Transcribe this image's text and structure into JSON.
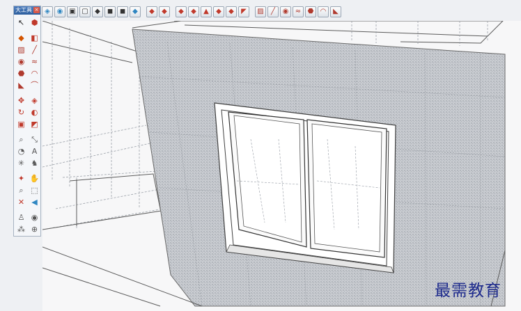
{
  "tool_palette": {
    "title": "大工具",
    "close_glyph": "×",
    "tools": [
      {
        "name": "select-tool-icon",
        "glyph": "↖",
        "color": "#222222"
      },
      {
        "name": "make-component-icon",
        "glyph": "⬢",
        "color": "#c0392b"
      },
      {
        "name": "paint-bucket-icon",
        "glyph": "◆",
        "color": "#d35400"
      },
      {
        "name": "eraser-icon",
        "glyph": "◧",
        "color": "#c0392b"
      },
      {
        "name": "rectangle-tool-icon",
        "glyph": "▨",
        "color": "#b03a2e"
      },
      {
        "name": "line-tool-icon",
        "glyph": "╱",
        "color": "#b03a2e"
      },
      {
        "name": "circle-tool-icon",
        "glyph": "◉",
        "color": "#b03a2e"
      },
      {
        "name": "freehand-tool-icon",
        "glyph": "≈",
        "color": "#b03a2e"
      },
      {
        "name": "polygon-tool-icon",
        "glyph": "⬣",
        "color": "#b03a2e"
      },
      {
        "name": "arc-tool-icon",
        "glyph": "◠",
        "color": "#b03a2e"
      },
      {
        "name": "pie-tool-icon",
        "glyph": "◣",
        "color": "#b03a2e"
      },
      {
        "name": "two-point-arc-icon",
        "glyph": "⌒",
        "color": "#b03a2e"
      },
      {
        "name": "move-tool-icon",
        "glyph": "✥",
        "color": "#c0392b"
      },
      {
        "name": "push-pull-tool-icon",
        "glyph": "◈",
        "color": "#c0392b"
      },
      {
        "name": "rotate-tool-icon",
        "glyph": "↻",
        "color": "#c0392b"
      },
      {
        "name": "follow-me-tool-icon",
        "glyph": "◐",
        "color": "#c0392b"
      },
      {
        "name": "scale-tool-icon",
        "glyph": "▣",
        "color": "#c0392b"
      },
      {
        "name": "offset-tool-icon",
        "glyph": "◩",
        "color": "#c0392b"
      },
      {
        "name": "tape-measure-icon",
        "glyph": "⌕",
        "color": "#555555"
      },
      {
        "name": "dimension-tool-icon",
        "glyph": "⤡",
        "color": "#555555"
      },
      {
        "name": "protractor-tool-icon",
        "glyph": "◔",
        "color": "#555555"
      },
      {
        "name": "text-tool-icon",
        "glyph": "A",
        "color": "#555555"
      },
      {
        "name": "axes-tool-icon",
        "glyph": "✳",
        "color": "#555555"
      },
      {
        "name": "3d-text-tool-icon",
        "glyph": "♞",
        "color": "#555555"
      },
      {
        "name": "orbit-tool-icon",
        "glyph": "✦",
        "color": "#c0392b"
      },
      {
        "name": "pan-tool-icon",
        "glyph": "✋",
        "color": "#555555"
      },
      {
        "name": "zoom-tool-icon",
        "glyph": "⌕",
        "color": "#555555"
      },
      {
        "name": "zoom-window-icon",
        "glyph": "⬚",
        "color": "#555555"
      },
      {
        "name": "zoom-extents-icon",
        "glyph": "✕",
        "color": "#c0392b"
      },
      {
        "name": "previous-view-icon",
        "glyph": "◀",
        "color": "#2e86c1"
      },
      {
        "name": "position-camera-icon",
        "glyph": "♙",
        "color": "#555555"
      },
      {
        "name": "look-around-icon",
        "glyph": "◉",
        "color": "#555555"
      },
      {
        "name": "walk-tool-icon",
        "glyph": "⁂",
        "color": "#555555"
      },
      {
        "name": "section-plane-icon",
        "glyph": "⊕",
        "color": "#555555"
      }
    ]
  },
  "top_toolbar": {
    "tools": [
      {
        "name": "iso-view-icon",
        "glyph": "◈",
        "color": "#2e86c1"
      },
      {
        "name": "top-view-icon",
        "glyph": "◉",
        "color": "#2e86c1"
      },
      {
        "name": "front-view-icon",
        "glyph": "▣",
        "color": "#333333"
      },
      {
        "name": "xray-style-icon",
        "glyph": "▢",
        "color": "#333333"
      },
      {
        "name": "wireframe-style-icon",
        "glyph": "◆",
        "color": "#333333"
      },
      {
        "name": "hidden-line-style-icon",
        "glyph": "◼",
        "color": "#333333"
      },
      {
        "name": "shaded-style-icon",
        "glyph": "◼",
        "color": "#333333"
      },
      {
        "name": "shaded-texture-style-icon",
        "glyph": "◆",
        "color": "#2e86c1"
      },
      {
        "name": "sep",
        "glyph": "",
        "color": ""
      },
      {
        "name": "solid-tools-union-icon",
        "glyph": "◆",
        "color": "#c0392b"
      },
      {
        "name": "solid-tools-subtract-icon",
        "glyph": "◆",
        "color": "#c0392b"
      },
      {
        "name": "sep",
        "glyph": "",
        "color": ""
      },
      {
        "name": "sandbox-from-contours-icon",
        "glyph": "◆",
        "color": "#c0392b"
      },
      {
        "name": "sandbox-from-scratch-icon",
        "glyph": "◆",
        "color": "#c0392b"
      },
      {
        "name": "sandbox-smoove-icon",
        "glyph": "▲",
        "color": "#c0392b"
      },
      {
        "name": "sandbox-stamp-icon",
        "glyph": "◆",
        "color": "#c0392b"
      },
      {
        "name": "sandbox-drape-icon",
        "glyph": "◆",
        "color": "#c0392b"
      },
      {
        "name": "sandbox-flip-edge-icon",
        "glyph": "◤",
        "color": "#c0392b"
      },
      {
        "name": "sep",
        "glyph": "",
        "color": ""
      },
      {
        "name": "rectangle-icon",
        "glyph": "▨",
        "color": "#b03a2e"
      },
      {
        "name": "line-icon",
        "glyph": "╱",
        "color": "#b03a2e"
      },
      {
        "name": "circle-icon",
        "glyph": "◉",
        "color": "#b03a2e"
      },
      {
        "name": "freehand-icon",
        "glyph": "≈",
        "color": "#b03a2e"
      },
      {
        "name": "polygon-icon",
        "glyph": "⬣",
        "color": "#b03a2e"
      },
      {
        "name": "arc-icon",
        "glyph": "◠",
        "color": "#b03a2e"
      },
      {
        "name": "pie-icon",
        "glyph": "◣",
        "color": "#b03a2e"
      }
    ]
  },
  "watermark": {
    "text": "最需教育"
  },
  "colors": {
    "wall_texture": "#b8bcc2",
    "line": "#4a4a4a",
    "guide": "#9aa0a8",
    "watermark": "#1d2a8c"
  }
}
